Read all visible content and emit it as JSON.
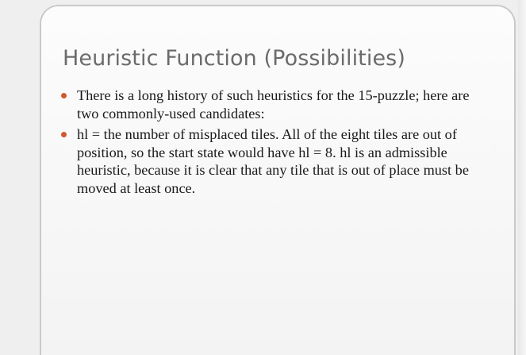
{
  "slide": {
    "title": "Heuristic Function (Possibilities)",
    "bullets": [
      {
        "text": "There is a long history of such heuristics for the 15-puzzle; here are two commonly-used candidates:"
      },
      {
        "text": "hl = the number of misplaced tiles. All of the eight tiles are out of position, so the start state would have hl = 8. hl is an admissible heuristic, because it is clear that any tile that is out of place must be moved at least once."
      }
    ]
  },
  "colors": {
    "bullet": "#d0582f",
    "title": "#6b6b6b",
    "body_text": "#1a1a1a"
  }
}
